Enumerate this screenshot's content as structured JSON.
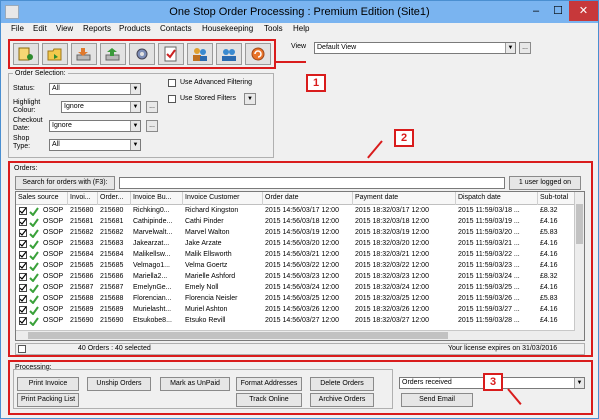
{
  "window": {
    "title": "One Stop Order Processing : Premium Edition (Site1)"
  },
  "titlebar_buttons": {
    "minimize": "–",
    "maximize": "☐",
    "close": "✕"
  },
  "menu": [
    "File",
    "Edit",
    "View",
    "Reports",
    "Products",
    "Contacts",
    "Housekeeping",
    "Tools",
    "Help"
  ],
  "toolbar_icons": [
    "new-order-icon",
    "open-icon",
    "download-icon",
    "upload-icon",
    "settings-icon",
    "checklist-icon",
    "users-icon",
    "contacts-icon",
    "refresh-icon"
  ],
  "view": {
    "label": "View",
    "value": "Default View",
    "more": "..."
  },
  "order_selection": {
    "title": "Order Selection:",
    "status_label": "Status:",
    "status_value": "All",
    "highlight_label": "Highlight Colour:",
    "highlight_value": "Ignore",
    "checkout_label": "Checkout Date:",
    "checkout_value": "Ignore",
    "shop_label": "Shop Type:",
    "shop_value": "All",
    "adv_filter_label": "Use Advanced Filtering",
    "stored_filter_label": "Use Stored Filters",
    "stored_filter_btn": "▼",
    "more": "..."
  },
  "orders": {
    "title": "Orders:",
    "search_button": "Search for orders with (F3):",
    "search_value": "",
    "logged_button": "1 user logged on",
    "columns": [
      "Sales source",
      "Invoi...",
      "Order...",
      "Invoice Bu...",
      "Invoice Customer",
      "Order date",
      "Payment date",
      "Dispatch date",
      "Sub-total"
    ],
    "rows": [
      [
        "OSOP",
        "215680",
        "215680",
        "Richking0...",
        "Richard Kingston",
        "2015 14:56/03/17 12:00",
        "2015 18:32/03/17 12:00",
        "2015 11:59/03/18 ...",
        "£8.32"
      ],
      [
        "OSOP",
        "215681",
        "215681",
        "Cathipinde...",
        "Cathi Pinder",
        "2015 14:56/03/18 12:00",
        "2015 18:32/03/18 12:00",
        "2015 11:59/03/19 ...",
        "£4.16"
      ],
      [
        "OSOP",
        "215682",
        "215682",
        "Marvelwalt...",
        "Marvel Walton",
        "2015 14:56/03/19 12:00",
        "2015 18:32/03/19 12:00",
        "2015 11:59/03/20 ...",
        "£5.83"
      ],
      [
        "OSOP",
        "215683",
        "215683",
        "Jakearzat...",
        "Jake Arzate",
        "2015 14:56/03/20 12:00",
        "2015 18:32/03/20 12:00",
        "2015 11:59/03/21 ...",
        "£4.16"
      ],
      [
        "OSOP",
        "215684",
        "215684",
        "Malikellsw...",
        "Malik Ellsworth",
        "2015 14:56/03/21 12:00",
        "2015 18:32/03/21 12:00",
        "2015 11:59/03/22 ...",
        "£4.16"
      ],
      [
        "OSOP",
        "215685",
        "215685",
        "Velmago1...",
        "Velma Goertz",
        "2015 14:56/03/22 12:00",
        "2015 18:32/03/22 12:00",
        "2015 11:59/03/23 ...",
        "£4.16"
      ],
      [
        "OSOP",
        "215686",
        "215686",
        "Mariella2...",
        "Marielle Ashford",
        "2015 14:56/03/23 12:00",
        "2015 18:32/03/23 12:00",
        "2015 11:59/03/24 ...",
        "£8.32"
      ],
      [
        "OSOP",
        "215687",
        "215687",
        "EmelynGe...",
        "Emely Noll",
        "2015 14:56/03/24 12:00",
        "2015 18:32/03/24 12:00",
        "2015 11:59/03/25 ...",
        "£4.16"
      ],
      [
        "OSOP",
        "215688",
        "215688",
        "Florencian...",
        "Florencia Neisler",
        "2015 14:56/03/25 12:00",
        "2015 18:32/03/25 12:00",
        "2015 11:59/03/26 ...",
        "£5.83"
      ],
      [
        "OSOP",
        "215689",
        "215689",
        "Murielasht...",
        "Muriel Ashton",
        "2015 14:56/03/26 12:00",
        "2015 18:32/03/26 12:00",
        "2015 11:59/03/27 ...",
        "£4.16"
      ],
      [
        "OSOP",
        "215690",
        "215690",
        "Etsukobe8...",
        "Etsuko Revill",
        "2015 14:56/03/27 12:00",
        "2015 18:32/03/27 12:00",
        "2015 11:59/03/28 ...",
        "£4.16"
      ]
    ],
    "status_count": "40 Orders : 40 selected",
    "license": "Your license expires on 31/03/2016"
  },
  "processing": {
    "title": "Processing:",
    "buttons": {
      "print_invoice": "Print Invoice",
      "print_packing": "Print Packing List",
      "unship": "Unship Orders",
      "mark_unpaid": "Mark as UnPaid",
      "format_addresses": "Format Addresses",
      "track_online": "Track Online",
      "delete_orders": "Delete Orders",
      "archive_orders": "Archive Orders",
      "send_email": "Send Email"
    },
    "email_template": "Orders received"
  },
  "callouts": [
    "1",
    "2",
    "3"
  ],
  "colors": {
    "accent_red": "#d91c1c",
    "titlebar": "#7ab4f0",
    "tick_green": "#3aa13a"
  }
}
